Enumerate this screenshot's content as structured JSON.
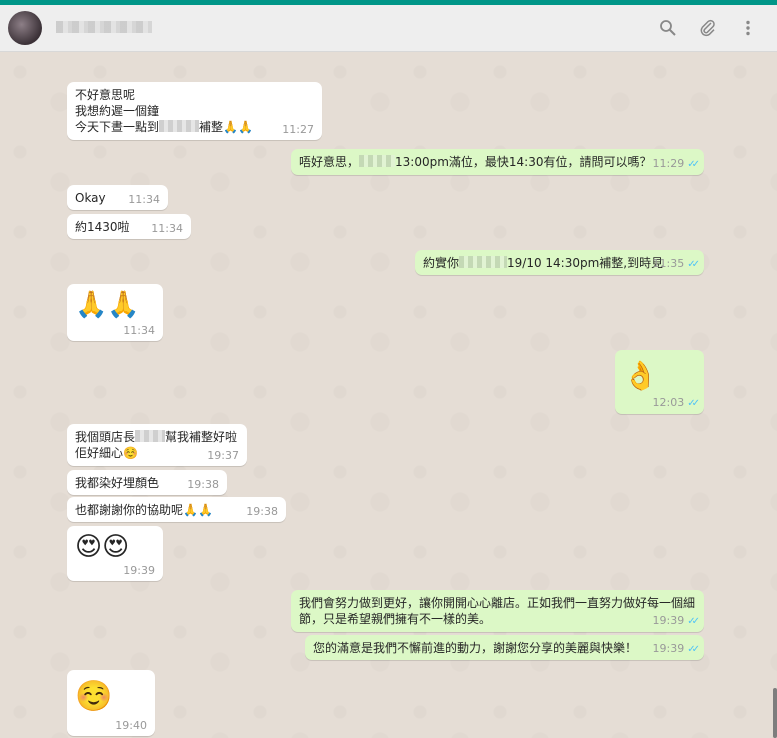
{
  "colors": {
    "accent": "#009688",
    "incoming": "#ffffff",
    "outgoing": "#dcf8c6",
    "ticks": "#4fc3f7"
  },
  "header": {
    "icons": {
      "search": "search-icon",
      "attach": "paperclip-icon",
      "menu": "more-vertical-icon"
    },
    "search_glyph": "⚲",
    "attach_glyph": "📎",
    "menu_glyph": "⋮"
  },
  "messages": [
    {
      "dir": "in",
      "lines": [
        "不好意思呢",
        "我想約遲一個鐘"
      ],
      "line3a": "今天下晝一點到",
      "line3b": "補整",
      "emoji": "🙏🙏",
      "time": "11:27"
    },
    {
      "dir": "out",
      "a": "唔好意思，",
      "b": "13:00pm滿位，最快14:30有位，請問可以嗎？",
      "time": "11:29",
      "ticks": "✓✓"
    },
    {
      "dir": "in",
      "text": "Okay",
      "time": "11:34"
    },
    {
      "dir": "in",
      "text": "約1430啦",
      "time": "11:34"
    },
    {
      "dir": "out",
      "a": "約實你",
      "b": "19/10 14:30pm補整,到時見",
      "time": "11:35",
      "ticks": "✓✓"
    },
    {
      "dir": "in",
      "emoji": "🙏🙏",
      "time": "11:34"
    },
    {
      "dir": "out",
      "emoji": "👌",
      "time": "12:03",
      "ticks": "✓✓"
    },
    {
      "dir": "in",
      "a": "我個頭店長",
      "b": "幫我補整好啦",
      "line2": "佢好細心",
      "emoji": "☺️",
      "time": "19:37"
    },
    {
      "dir": "in",
      "text": "我都染好埋顏色",
      "time": "19:38"
    },
    {
      "dir": "in",
      "text": "也都謝謝你的協助呢",
      "emoji": "🙏🙏",
      "time": "19:38"
    },
    {
      "dir": "in",
      "emoji": "😍😍",
      "time": "19:39"
    },
    {
      "dir": "out",
      "lines": [
        "我們會努力做到更好，讓你開開心心離店。正如我們一直努力做好每一個細",
        "節，只是希望親們擁有不一樣的美。"
      ],
      "time": "19:39",
      "ticks": "✓✓"
    },
    {
      "dir": "out",
      "text": "您的滿意是我們不懈前進的動力，謝謝您分享的美麗與快樂！",
      "time": "19:39",
      "ticks": "✓✓"
    },
    {
      "dir": "in",
      "emoji": "☺️",
      "time": "19:40"
    }
  ]
}
